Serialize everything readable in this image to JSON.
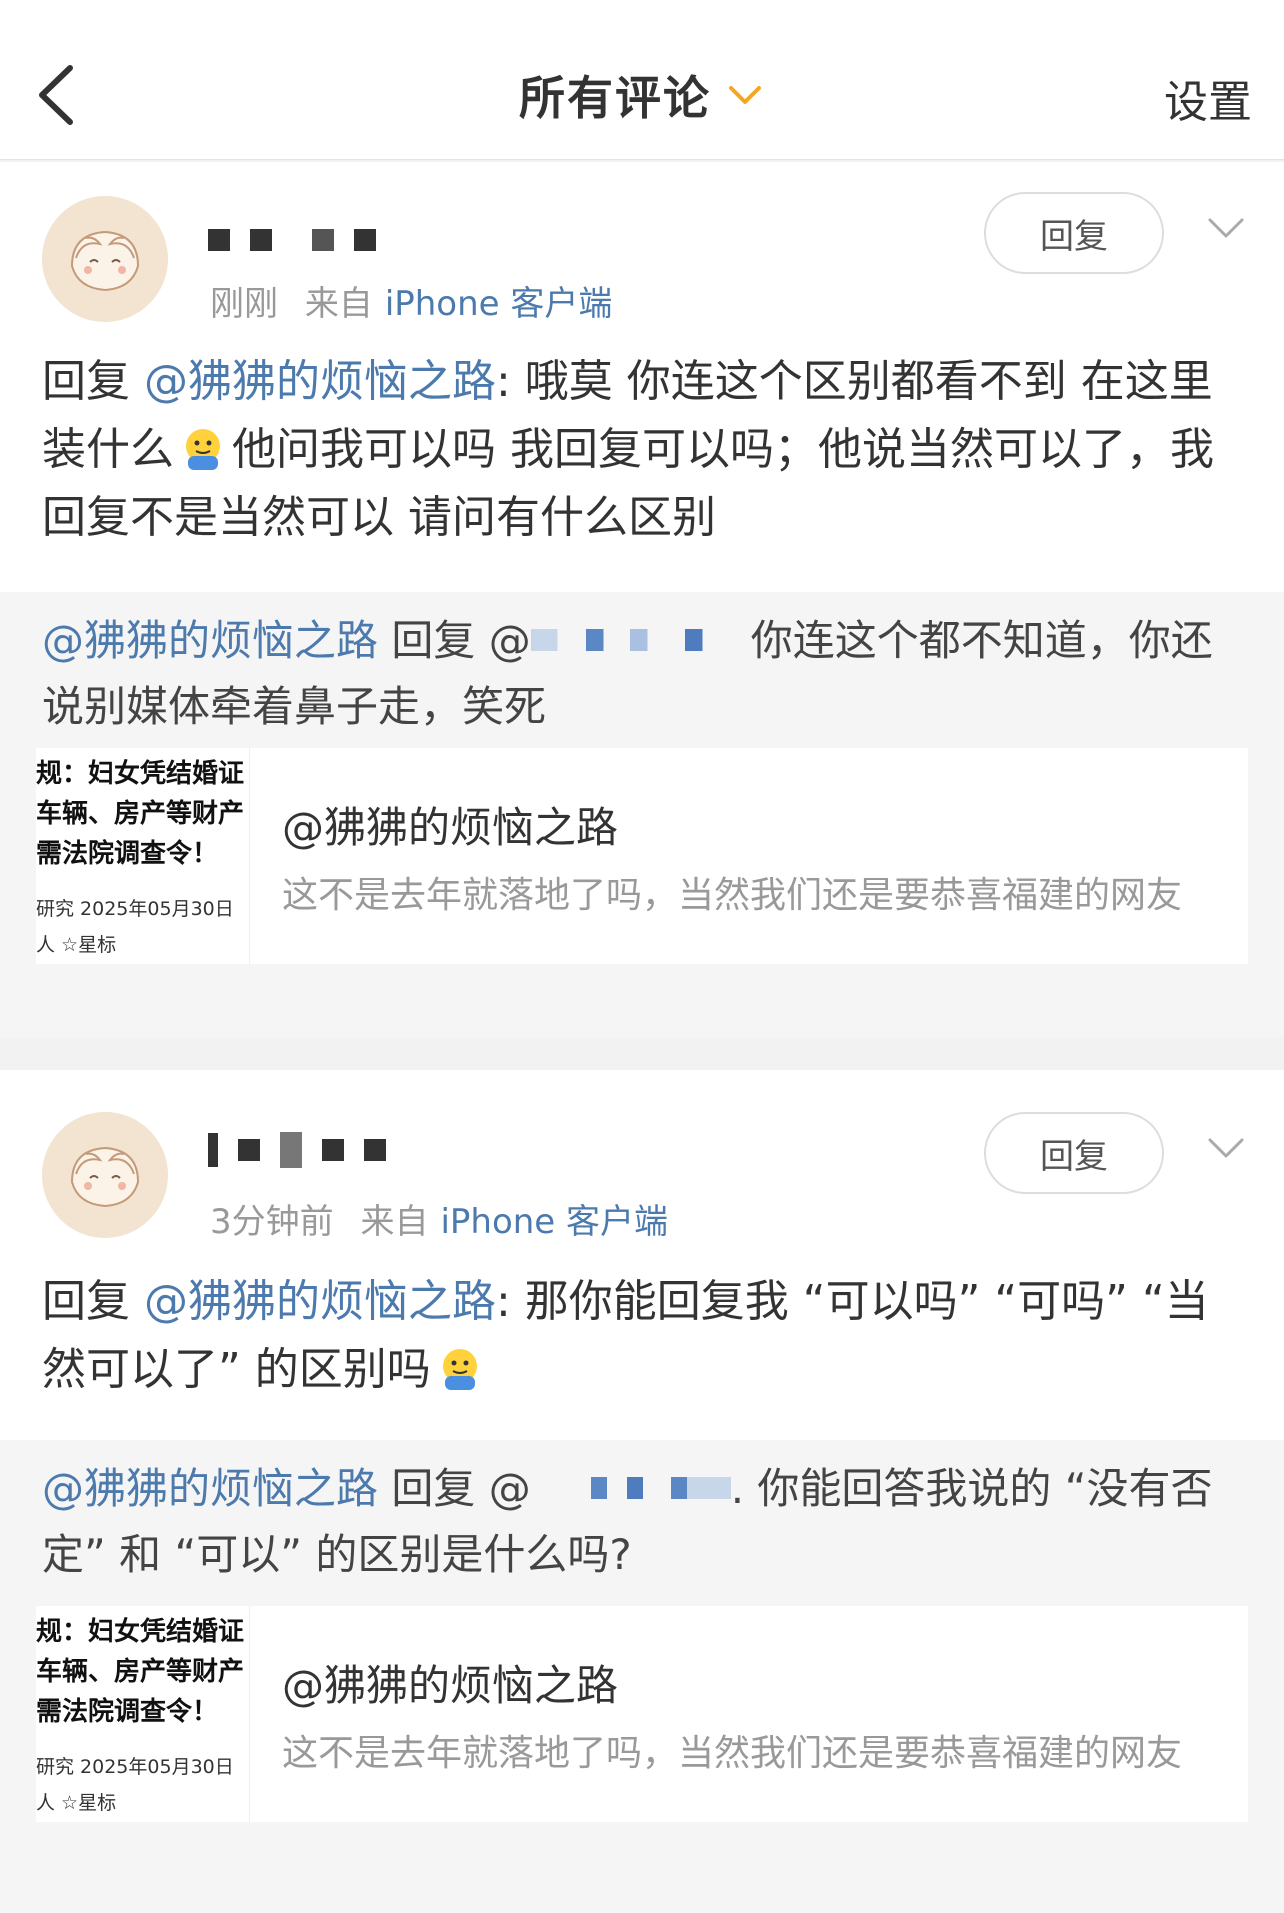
{
  "nav": {
    "title": "所有评论",
    "settings_label": "设置",
    "accent_color": "#f5a623"
  },
  "comments": [
    {
      "time": "刚刚",
      "source_prefix": "来自",
      "source": "iPhone 客户端",
      "reply_label": "回复",
      "text": {
        "prefix": "回复 ",
        "mention": "@狒狒的烦恼之路",
        "body_before_emoji": ": 哦莫 你连这个区别都看不到  在这里装什么",
        "emoji": "smiling-face-icon",
        "body_after_emoji": "他问我可以吗  我回复可以吗；他说当然可以了，我回复不是当然可以  请问有什么区别"
      },
      "quote": {
        "mention": "@狒狒的烦恼之路",
        "reply_word": " 回复 @",
        "body": "你连这个都不知道，你还说别媒体牵着鼻子走，笑死"
      },
      "origin": {
        "thumb_lines": [
          "规：妇女凭结婚证",
          "车辆、房产等财产",
          "需法院调查令！"
        ],
        "thumb_meta": [
          "研究  2025年05月30日",
          "人  ☆星标"
        ],
        "author": "@狒狒的烦恼之路",
        "excerpt": "这不是去年就落地了吗，当然我们还是要恭喜福建的网友"
      }
    },
    {
      "time": "3分钟前",
      "source_prefix": "来自",
      "source": "iPhone 客户端",
      "reply_label": "回复",
      "text": {
        "prefix": "回复 ",
        "mention": "@狒狒的烦恼之路",
        "body_before_emoji": ": 那你能回复我 “可以吗” “可吗” “当然可以了” 的区别吗",
        "emoji": "smiling-face-icon"
      },
      "quote": {
        "mention": "@狒狒的烦恼之路",
        "reply_word": " 回复 @",
        "body": ". 你能回答我说的 “没有否定” 和 “可以” 的区别是什么吗?"
      },
      "origin": {
        "thumb_lines": [
          "规：妇女凭结婚证",
          "车辆、房产等财产",
          "需法院调查令！"
        ],
        "thumb_meta": [
          "研究  2025年05月30日",
          "人  ☆星标"
        ],
        "author": "@狒狒的烦恼之路",
        "excerpt": "这不是去年就落地了吗，当然我们还是要恭喜福建的网友"
      }
    }
  ]
}
